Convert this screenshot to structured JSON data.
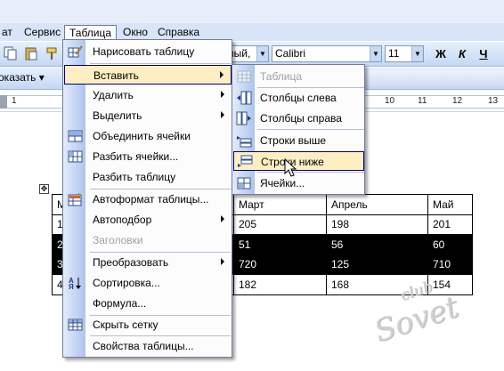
{
  "menubar": {
    "items": [
      "ат",
      "Сервис",
      "Таблица",
      "Окно",
      "Справка"
    ],
    "active": "Таблица"
  },
  "toolbar": {
    "style_combo": "ный,",
    "font_combo": "Calibri",
    "size_combo": "11",
    "bold": "Ж",
    "italic": "К",
    "underline": "Ч"
  },
  "toolbar2": {
    "show_label": "оказать ▾"
  },
  "ruler": {
    "left_numbers": [
      "1"
    ],
    "right_numbers": [
      "10",
      "11",
      "12",
      "13"
    ]
  },
  "table_menu": {
    "items": [
      {
        "label": "Нарисовать таблицу",
        "icon": "pencil-table-icon",
        "submenu": false,
        "disabled": false
      },
      {
        "label": "Вставить",
        "icon": "",
        "submenu": true,
        "disabled": false,
        "highlighted": true
      },
      {
        "label": "Удалить",
        "icon": "",
        "submenu": true,
        "disabled": false
      },
      {
        "label": "Выделить",
        "icon": "",
        "submenu": true,
        "disabled": false
      },
      {
        "label": "Объединить ячейки",
        "icon": "merge-cells-icon",
        "submenu": false,
        "disabled": false
      },
      {
        "label": "Разбить ячейки...",
        "icon": "split-cells-icon",
        "submenu": false,
        "disabled": false
      },
      {
        "label": "Разбить таблицу",
        "icon": "",
        "submenu": false,
        "disabled": false
      },
      {
        "label": "Автоформат таблицы...",
        "icon": "autoformat-icon",
        "submenu": false,
        "disabled": false
      },
      {
        "label": "Автоподбор",
        "icon": "",
        "submenu": true,
        "disabled": false
      },
      {
        "label": "Заголовки",
        "icon": "",
        "submenu": false,
        "disabled": true
      },
      {
        "label": "Преобразовать",
        "icon": "",
        "submenu": true,
        "disabled": false
      },
      {
        "label": "Сортировка...",
        "icon": "sort-az-icon",
        "submenu": false,
        "disabled": false
      },
      {
        "label": "Формула...",
        "icon": "",
        "submenu": false,
        "disabled": false
      },
      {
        "label": "Скрыть сетку",
        "icon": "grid-icon",
        "submenu": false,
        "disabled": false
      },
      {
        "label": "Свойства таблицы...",
        "icon": "",
        "submenu": false,
        "disabled": false
      }
    ]
  },
  "insert_submenu": {
    "items": [
      {
        "label": "Таблица",
        "icon": "table-icon",
        "disabled": true
      },
      {
        "label": "Столбцы слева",
        "icon": "columns-left-icon",
        "disabled": false
      },
      {
        "label": "Столбцы справа",
        "icon": "columns-right-icon",
        "disabled": false
      },
      {
        "label": "Строки выше",
        "icon": "rows-above-icon",
        "disabled": false
      },
      {
        "label": "Строки ниже",
        "icon": "rows-below-icon",
        "disabled": false,
        "highlighted": true
      },
      {
        "label": "Ячейки...",
        "icon": "cells-icon",
        "disabled": false
      }
    ]
  },
  "document_table": {
    "rows": [
      {
        "cells": [
          "М",
          "",
          "Март",
          "Апрель",
          "Май"
        ],
        "selected": false
      },
      {
        "cells": [
          "1",
          "",
          "205",
          "198",
          "201"
        ],
        "selected": false
      },
      {
        "cells": [
          "2",
          "",
          "51",
          "56",
          "60"
        ],
        "selected": true
      },
      {
        "cells": [
          "3",
          "",
          "720",
          "125",
          "710"
        ],
        "selected": true
      },
      {
        "cells": [
          "4",
          "",
          "182",
          "168",
          "154"
        ],
        "selected": false
      }
    ]
  },
  "watermark": {
    "small": "club",
    "big": "Sovet"
  },
  "colors": {
    "menu_highlight": "#ffeec2",
    "menu_highlight_border": "#000080",
    "rail": "#adc4ec",
    "toolbar": "#c4d7f4"
  }
}
